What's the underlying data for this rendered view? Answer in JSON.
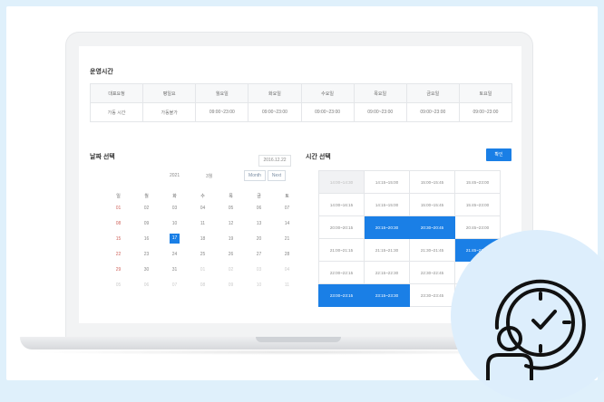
{
  "hours": {
    "title": "운영시간",
    "days": [
      "대표요청",
      "평일요",
      "월요일",
      "화요일",
      "수요일",
      "목요일",
      "금요일",
      "토요일"
    ],
    "values": [
      "가동 시간",
      "가동불가",
      "09:00~23:00",
      "09:00~23:00",
      "09:00~23:00",
      "09:00~23:00",
      "09:00~23:00",
      "09:00~23:00"
    ]
  },
  "date_select": {
    "title": "날짜 선택",
    "input_value": "2016.12.22",
    "year": "2021",
    "month": "3월",
    "prev_label": "Month",
    "next_label": "Next",
    "weekdays": [
      "일",
      "월",
      "화",
      "수",
      "목",
      "금",
      "토"
    ],
    "weeks": [
      [
        "01",
        "02",
        "03",
        "04",
        "05",
        "06",
        "07"
      ],
      [
        "08",
        "09",
        "10",
        "11",
        "12",
        "13",
        "14"
      ],
      [
        "15",
        "16",
        "17",
        "18",
        "19",
        "20",
        "21"
      ],
      [
        "22",
        "23",
        "24",
        "25",
        "26",
        "27",
        "28"
      ],
      [
        "29",
        "30",
        "31",
        "01",
        "02",
        "03",
        "04"
      ],
      [
        "05",
        "06",
        "07",
        "08",
        "09",
        "10",
        "11"
      ]
    ],
    "selected_day": "17"
  },
  "time_select": {
    "title": "시간 선택",
    "confirm_label": "확인",
    "slots": [
      [
        "14:00~14:30",
        "14:15~15:00",
        "15:00~15:45",
        "15:45~23:00"
      ],
      [
        "14:00~16:15",
        "14:15~15:00",
        "15:00~15:45",
        "15:45~23:00"
      ],
      [
        "20:00~20:15",
        "20:15~20:30",
        "20:30~20:45",
        "20:45~23:00"
      ],
      [
        "21:00~21:15",
        "21:15~21:30",
        "21:30~21:45",
        "21:45~22:00"
      ],
      [
        "22:00~22:15",
        "22:15~22:30",
        "22:30~22:45",
        "22:45~23:00"
      ],
      [
        "23:00~23:15",
        "23:15~23:30",
        "23:30~23:45",
        ""
      ]
    ],
    "selected": [
      "2-1",
      "2-2",
      "3-3",
      "5-0",
      "5-1"
    ],
    "disabled": [
      "0-0"
    ]
  },
  "colors": {
    "accent": "#1a7fe6",
    "background": "#dff0fb",
    "icon_circle": "#ddeefc"
  },
  "icons": {
    "badge": "person-clock-icon"
  }
}
